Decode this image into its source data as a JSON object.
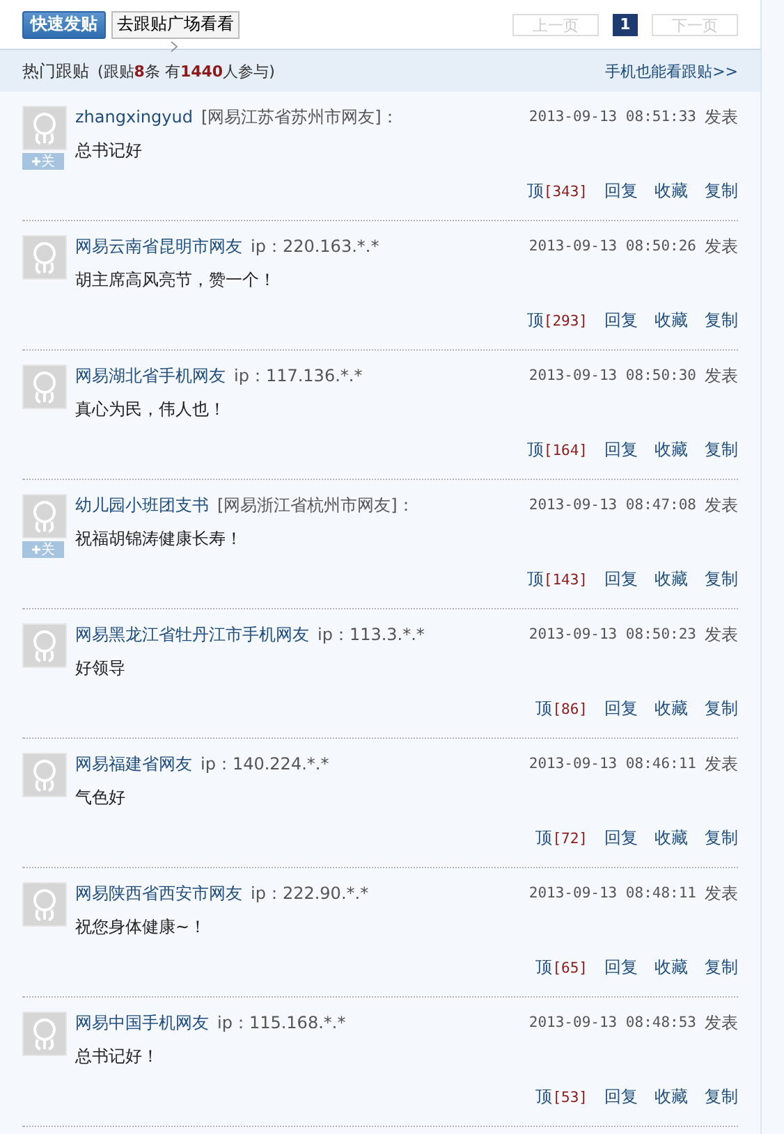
{
  "toolbar": {
    "post_button": "快速发贴",
    "plaza_button": "去跟贴广场看看",
    "pagination": [
      {
        "label": "上一页",
        "kind": "nav",
        "disabled": true
      },
      {
        "label": "1",
        "kind": "page",
        "selected": true
      },
      {
        "label": "下一页",
        "kind": "nav",
        "disabled": true
      }
    ]
  },
  "header": {
    "title": "热门跟贴",
    "summary": "(跟贴**8**条 有**1440**人参与)",
    "mobile_link": "手机也能看跟贴>>"
  },
  "posts": [
    {
      "user": "zhangxingyud",
      "origin": "[网易江苏省苏州市网友]：",
      "follow_label": "关",
      "time": "2013-09-13 08:51:33",
      "posted": "发表",
      "content": "总书记好",
      "up": "顶",
      "up_count": "[343]",
      "actions": [
        "回复",
        "收藏",
        "复制"
      ]
    },
    {
      "user": "网易云南省昆明市网友",
      "origin": "ip：220.163.*.*",
      "time": "2013-09-13 08:50:26",
      "posted": "发表",
      "content": "胡主席高风亮节，赞一个！",
      "up": "顶",
      "up_count": "[293]",
      "actions": [
        "回复",
        "收藏",
        "复制"
      ]
    },
    {
      "user": "网易湖北省手机网友",
      "origin": "ip：117.136.*.*",
      "time": "2013-09-13 08:50:30",
      "posted": "发表",
      "content": "真心为民，伟人也！",
      "up": "顶",
      "up_count": "[164]",
      "actions": [
        "回复",
        "收藏",
        "复制"
      ]
    },
    {
      "user": "幼儿园小班团支书",
      "origin": "[网易浙江省杭州市网友]：",
      "follow_label": "关",
      "time": "2013-09-13 08:47:08",
      "posted": "发表",
      "content": "祝福胡锦涛健康长寿！",
      "up": "顶",
      "up_count": "[143]",
      "actions": [
        "回复",
        "收藏",
        "复制"
      ]
    },
    {
      "user": "网易黑龙江省牡丹江市手机网友",
      "origin": "ip：113.3.*.*",
      "time": "2013-09-13 08:50:23",
      "posted": "发表",
      "content": "好领导",
      "up": "顶",
      "up_count": "[86]",
      "actions": [
        "回复",
        "收藏",
        "复制"
      ]
    },
    {
      "user": "网易福建省网友",
      "origin": "ip：140.224.*.*",
      "time": "2013-09-13 08:46:11",
      "posted": "发表",
      "content": "气色好",
      "up": "顶",
      "up_count": "[72]",
      "actions": [
        "回复",
        "收藏",
        "复制"
      ]
    },
    {
      "user": "网易陕西省西安市网友",
      "origin": "ip：222.90.*.*",
      "time": "2013-09-13 08:48:11",
      "posted": "发表",
      "content": "祝您身体健康~！",
      "up": "顶",
      "up_count": "[65]",
      "actions": [
        "回复",
        "收藏",
        "复制"
      ]
    },
    {
      "user": "网易中国手机网友",
      "origin": "ip：115.168.*.*",
      "time": "2013-09-13 08:48:53",
      "posted": "发表",
      "content": "总书记好！",
      "up": "顶",
      "up_count": "[53]",
      "actions": [
        "回复",
        "收藏",
        "复制"
      ]
    }
  ]
}
